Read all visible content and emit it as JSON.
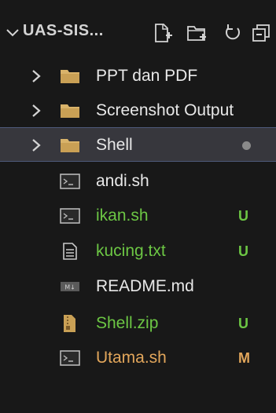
{
  "explorer": {
    "title": "UAS-SIS...",
    "actions": [
      "new-file",
      "new-folder",
      "refresh",
      "collapse-all"
    ]
  },
  "items": [
    {
      "label": "PPT dan PDF",
      "kind": "folder",
      "badge": ""
    },
    {
      "label": "Screenshot Output",
      "kind": "folder",
      "badge": ""
    },
    {
      "label": "Shell",
      "kind": "folder",
      "badge": "",
      "selected": true,
      "modified_dot": true
    },
    {
      "label": "andi.sh",
      "kind": "shell",
      "badge": ""
    },
    {
      "label": "ikan.sh",
      "kind": "shell",
      "badge": "U"
    },
    {
      "label": "kucing.txt",
      "kind": "text",
      "badge": "U"
    },
    {
      "label": "README.md",
      "kind": "markdown",
      "badge": ""
    },
    {
      "label": "Shell.zip",
      "kind": "zip",
      "badge": "U"
    },
    {
      "label": "Utama.sh",
      "kind": "shell",
      "badge": "M"
    }
  ],
  "colors": {
    "background": "#181818",
    "selected": "#37373d",
    "untracked": "#6cc644",
    "modified": "#e2a65b",
    "folder": "#d9b36a"
  }
}
